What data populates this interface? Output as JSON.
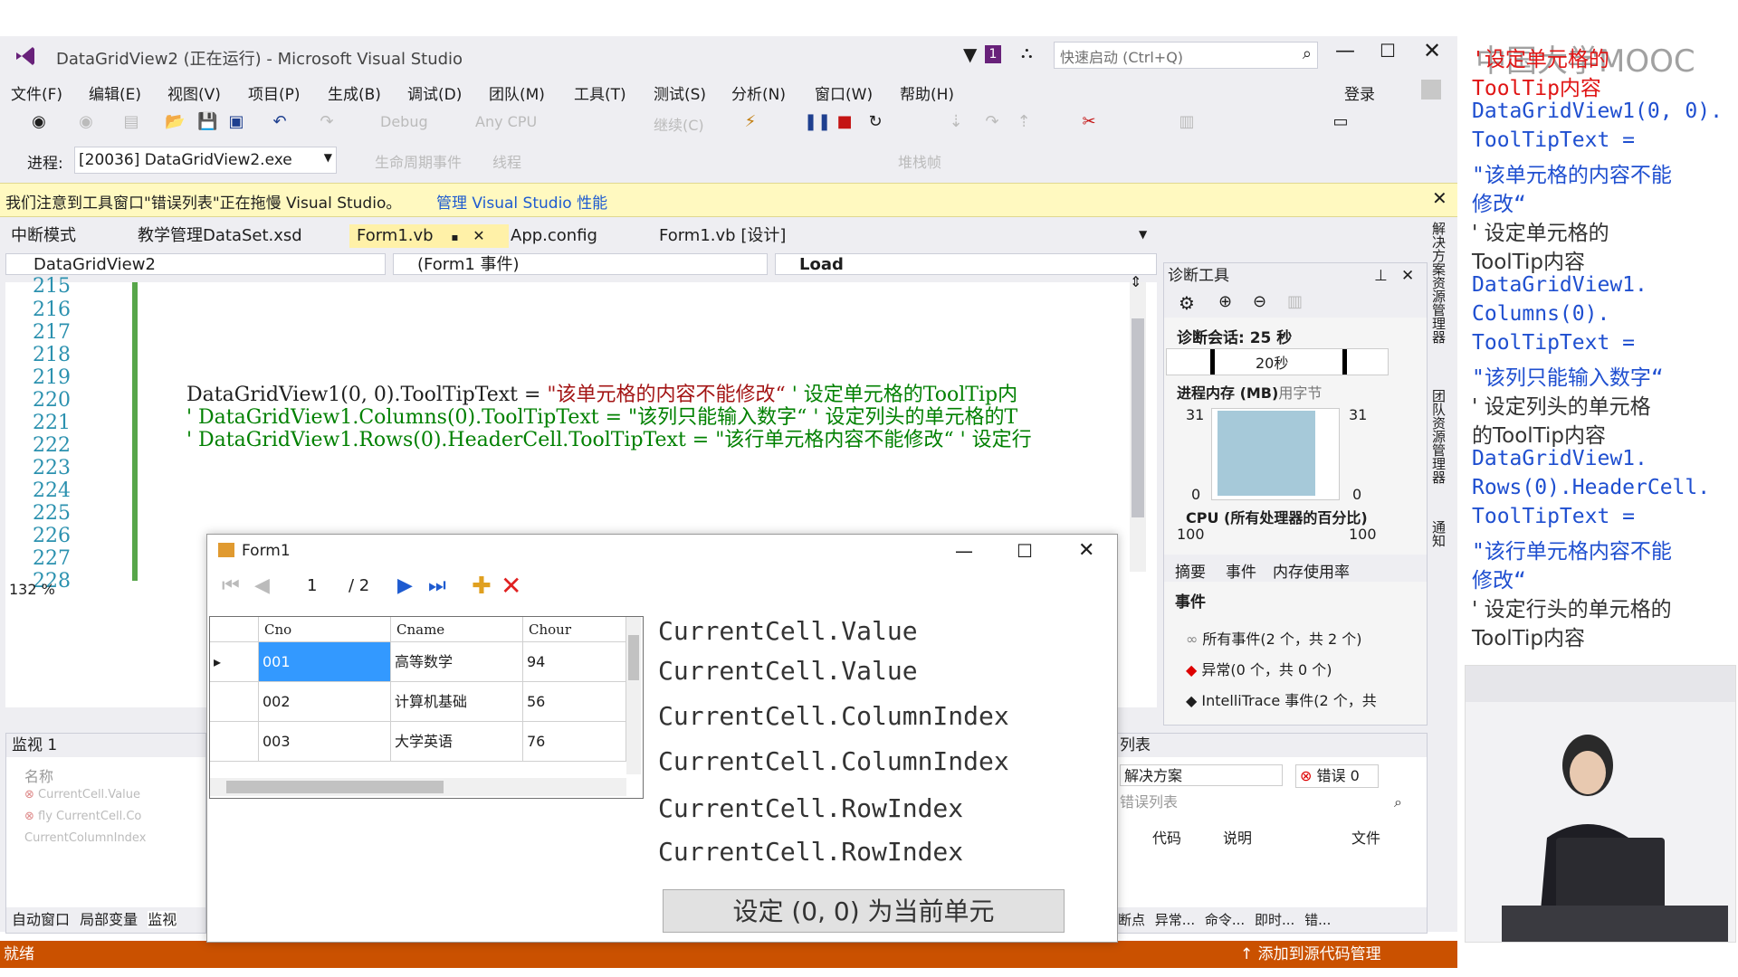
{
  "window": {
    "title": "DataGridView2 (正在运行) - Microsoft Visual Studio",
    "quick_launch_placeholder": "快速启动 (Ctrl+Q)",
    "notification_count": "1",
    "login": "登录"
  },
  "menu": [
    "文件(F)",
    "编辑(E)",
    "视图(V)",
    "项目(P)",
    "生成(B)",
    "调试(D)",
    "团队(M)",
    "工具(T)",
    "测试(S)",
    "分析(N)",
    "窗口(W)",
    "帮助(H)"
  ],
  "toolbar": {
    "config_label": "Debug",
    "platform_label": "Any CPU",
    "continue_label": "继续(C)"
  },
  "process_bar": {
    "label": "进程:",
    "process": "[20036] DataGridView2.exe",
    "lifecycle": "生命周期事件",
    "thread": "线程",
    "stack_frame": "堆栈帧"
  },
  "info_bar": {
    "message": "我们注意到工具窗口\"错误列表\"正在拖慢 Visual Studio。",
    "link": "管理 Visual Studio 性能"
  },
  "doc_tabs": {
    "mode": "中断模式",
    "items": [
      "教学管理DataSet.xsd",
      "Form1.vb",
      "App.config",
      "Form1.vb [设计]"
    ]
  },
  "nav": {
    "project": "DataGridView2",
    "events": "(Form1 事件)",
    "member": "Load"
  },
  "editor": {
    "line_numbers": [
      "215",
      "216",
      "217",
      "218",
      "219",
      "220",
      "221",
      "222",
      "223",
      "224",
      "225",
      "226",
      "227",
      "228"
    ],
    "line220_code": "DataGridView1(0, 0).ToolTipText = ",
    "line220_str": "\"该单元格的内容不能修改“",
    "line220_cmt": "' 设定单元格的ToolTip内",
    "line221_cmt": "' DataGridView1.Columns(0).ToolTipText = \"该列只能输入数字“  ' 设定列头的单元格的T",
    "line222_cmt": "' DataGridView1.Rows(0).HeaderCell.ToolTipText = \"该行单元格内容不能修改“  ' 设定行",
    "zoom": "132 %"
  },
  "diag": {
    "title": "诊断工具",
    "session": "诊断会话: 25 秒",
    "timeline_label": "20秒",
    "memory_title": "进程内存 (MB)",
    "memory_suffix": "用字节",
    "mem_left_max": "31",
    "mem_right_max": "31",
    "mem_left_min": "0",
    "mem_right_min": "0",
    "cpu_title": "CPU (所有处理器的百分比)",
    "cpu_left": "100",
    "cpu_right": "100",
    "tabs": [
      "摘要",
      "事件",
      "内存使用率"
    ],
    "events_head": "事件",
    "events": [
      "所有事件(2 个，共 2 个)",
      "异常(0 个，共 0 个)",
      "IntelliTrace 事件(2 个，共"
    ]
  },
  "side_tabs": [
    "解决方案资源管理器",
    "团队资源管理器",
    "通知"
  ],
  "watch": {
    "title": "监视 1",
    "col_name": "名称",
    "rows": [
      "CurrentCell.Value",
      "fly CurrentCell.Co",
      "CurrentColumnIndex"
    ],
    "bottom_tabs": [
      "自动窗口",
      "局部变量",
      "监视"
    ]
  },
  "errorlist": {
    "title": "列表",
    "scope": "解决方案",
    "errors": "错误 0",
    "search": "错误列表",
    "cols": [
      "代码",
      "说明",
      "文件"
    ],
    "bottom_tabs": [
      "断点",
      "异常...",
      "命令...",
      "即时...",
      "错..."
    ]
  },
  "status": {
    "left": "就绪",
    "right": "添加到源代码管理"
  },
  "form1": {
    "title": "Form1",
    "position": "1",
    "count": "/ 2",
    "headers": [
      "Cno",
      "Cname",
      "Chour"
    ],
    "rows": [
      {
        "cno": "001",
        "cname": "高等数学",
        "chour": "94"
      },
      {
        "cno": "002",
        "cname": "计算机基础",
        "chour": "56"
      },
      {
        "cno": "003",
        "cname": "大学英语",
        "chour": "76"
      }
    ],
    "labels": [
      "CurrentCell.Value",
      "CurrentCell.Value",
      "CurrentCell.ColumnIndex",
      "CurrentCell.ColumnIndex",
      "CurrentCell.RowIndex",
      "CurrentCell.RowIndex"
    ],
    "button": "设定 (0, 0) 为当前单元"
  },
  "notes": {
    "watermark": "中国大学MOOC",
    "lines": [
      {
        "text": "'设定单元格的",
        "style": "red"
      },
      {
        "text": "ToolTip内容",
        "style": "red"
      },
      {
        "text": "DataGridView1(0, 0).",
        "style": "blue"
      },
      {
        "text": "ToolTipText =",
        "style": "blue"
      },
      {
        "text": "\"该单元格的内容不能",
        "style": "blue"
      },
      {
        "text": "修改“",
        "style": "blue"
      },
      {
        "text": "' 设定单元格的",
        "style": "dark"
      },
      {
        "text": "ToolTip内容",
        "style": "dark"
      },
      {
        "text": "DataGridView1.",
        "style": "blue"
      },
      {
        "text": "Columns(0).",
        "style": "blue"
      },
      {
        "text": "ToolTipText =",
        "style": "blue"
      },
      {
        "text": "\"该列只能输入数字“",
        "style": "blue"
      },
      {
        "text": "' 设定列头的单元格",
        "style": "dark"
      },
      {
        "text": "的ToolTip内容",
        "style": "dark"
      },
      {
        "text": "DataGridView1.",
        "style": "blue"
      },
      {
        "text": "Rows(0).HeaderCell.",
        "style": "blue"
      },
      {
        "text": "ToolTipText =",
        "style": "blue"
      },
      {
        "text": "\"该行单元格内容不能",
        "style": "blue"
      },
      {
        "text": "修改“",
        "style": "blue"
      },
      {
        "text": "' 设定行头的单元格的",
        "style": "dark"
      },
      {
        "text": "ToolTip内容",
        "style": "dark"
      }
    ]
  },
  "colors": {
    "accent": "#68217a",
    "status_bar": "#ca5100",
    "selected_cell": "#3399ff",
    "info_bar": "#fff9c0"
  }
}
